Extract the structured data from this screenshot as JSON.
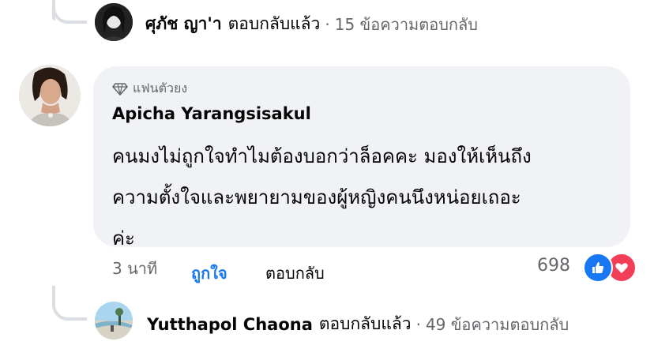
{
  "top_reply": {
    "name": "ศุภัช ญา'า",
    "action": "ตอบกลับแล้ว",
    "separator": "·",
    "count": "15 ข้อความตอบกลับ"
  },
  "comment": {
    "badge_icon": "diamond-icon",
    "badge": "แฟนตัวยง",
    "author": "Apicha Yarangsisakul",
    "lines": [
      "คนมงไม่ถูกใจทำไมต้องบอกว่าล็อคคะ มองให้เห็นถึง",
      "ความตั้งใจและพยายามของผู้หญิงคนนึงหน่อยเถอะ",
      "ค่ะ"
    ],
    "time": "3 นาที",
    "like_label": "ถูกใจ",
    "reply_label": "ตอบกลับ",
    "reaction_count": "698",
    "reaction_icons": [
      "like-reaction-icon",
      "love-reaction-icon"
    ],
    "colors": {
      "like": "#1877f2",
      "love": "#f33e58"
    }
  },
  "bottom_reply": {
    "name": "Yutthapol Chaona",
    "action": "ตอบกลับแล้ว",
    "separator": "·",
    "count": "49 ข้อความตอบกลับ"
  }
}
